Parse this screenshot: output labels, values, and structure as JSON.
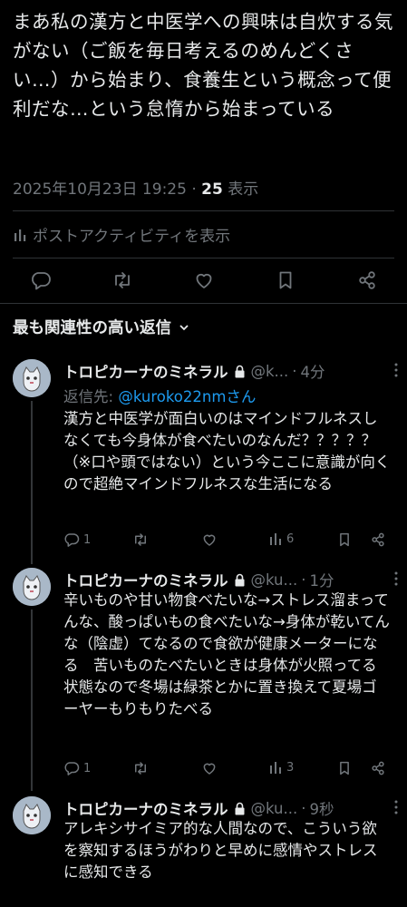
{
  "post": {
    "text": "まあ私の漢方と中医学への興味は自炊する気がない（ご飯を毎日考えるのめんどくさい…）から始まり、食養生という概念って便利だな…という怠惰から始まっている",
    "timestamp": "2025年10月23日 19:25",
    "separator": "·",
    "views_count": "25",
    "views_label": "表示",
    "activity_label": "ポストアクティビティを表示"
  },
  "section": {
    "title": "最も関連性の高い返信"
  },
  "replies": [
    {
      "name": "トロピカーナのミネラル",
      "handle": "@k...",
      "separator": "·",
      "time": "4分",
      "reply_to_prefix": "返信先: ",
      "reply_to_mention": "@kuroko22nmさん",
      "text": "漢方と中医学が面白いのはマインドフルネスしなくても今身体が食べたいのなんだ？？？？？（※口や頭ではない）という今ここに意識が向くので超絶マインドフルネスな生活になる",
      "replies": "1",
      "views": "6"
    },
    {
      "name": "トロピカーナのミネラル",
      "handle": "@ku...",
      "separator": "·",
      "time": "1分",
      "text": "辛いものや甘い物食べたいな→ストレス溜まってんな、酸っぱいもの食べたいな→身体が乾いてんな（陰虚）てなるので食欲が健康メーターになる　苦いものたべたいときは身体が火照ってる状態なので冬場は緑茶とかに置き換えて夏場ゴーヤーもりもりたべる",
      "replies": "1",
      "views": "3"
    },
    {
      "name": "トロピカーナのミネラル",
      "handle": "@ku...",
      "separator": "·",
      "time": "9秒",
      "text": "アレキシサイミア的な人間なので、こういう欲を察知するほうがわりと早めに感情やストレスに感知できる"
    }
  ],
  "colors": {
    "background": "#000000",
    "text": "#e7e9ea",
    "muted": "#71767b",
    "accent": "#1d9bf0",
    "divider": "#2f3336"
  },
  "icons": [
    "bar-chart-icon",
    "reply-icon",
    "retweet-icon",
    "like-icon",
    "bookmark-icon",
    "share-icon",
    "chevron-down-icon",
    "lock-icon",
    "more-icon",
    "views-icon"
  ]
}
